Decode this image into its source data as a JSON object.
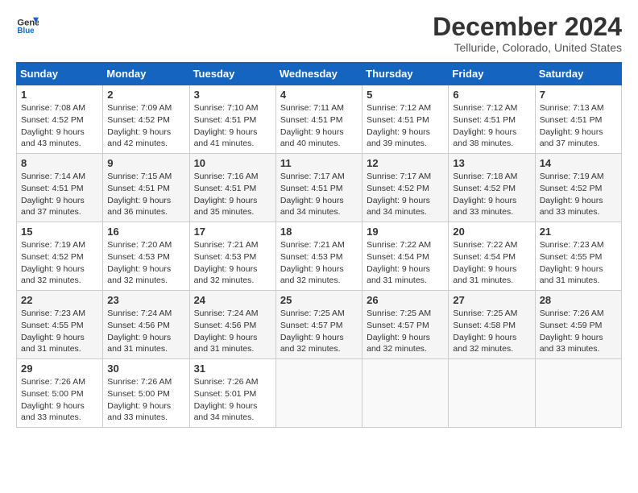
{
  "logo": {
    "line1": "General",
    "line2": "Blue"
  },
  "title": "December 2024",
  "subtitle": "Telluride, Colorado, United States",
  "weekdays": [
    "Sunday",
    "Monday",
    "Tuesday",
    "Wednesday",
    "Thursday",
    "Friday",
    "Saturday"
  ],
  "weeks": [
    [
      {
        "day": "1",
        "sunrise": "7:08 AM",
        "sunset": "4:52 PM",
        "daylight": "9 hours and 43 minutes."
      },
      {
        "day": "2",
        "sunrise": "7:09 AM",
        "sunset": "4:52 PM",
        "daylight": "9 hours and 42 minutes."
      },
      {
        "day": "3",
        "sunrise": "7:10 AM",
        "sunset": "4:51 PM",
        "daylight": "9 hours and 41 minutes."
      },
      {
        "day": "4",
        "sunrise": "7:11 AM",
        "sunset": "4:51 PM",
        "daylight": "9 hours and 40 minutes."
      },
      {
        "day": "5",
        "sunrise": "7:12 AM",
        "sunset": "4:51 PM",
        "daylight": "9 hours and 39 minutes."
      },
      {
        "day": "6",
        "sunrise": "7:12 AM",
        "sunset": "4:51 PM",
        "daylight": "9 hours and 38 minutes."
      },
      {
        "day": "7",
        "sunrise": "7:13 AM",
        "sunset": "4:51 PM",
        "daylight": "9 hours and 37 minutes."
      }
    ],
    [
      {
        "day": "8",
        "sunrise": "7:14 AM",
        "sunset": "4:51 PM",
        "daylight": "9 hours and 37 minutes."
      },
      {
        "day": "9",
        "sunrise": "7:15 AM",
        "sunset": "4:51 PM",
        "daylight": "9 hours and 36 minutes."
      },
      {
        "day": "10",
        "sunrise": "7:16 AM",
        "sunset": "4:51 PM",
        "daylight": "9 hours and 35 minutes."
      },
      {
        "day": "11",
        "sunrise": "7:17 AM",
        "sunset": "4:51 PM",
        "daylight": "9 hours and 34 minutes."
      },
      {
        "day": "12",
        "sunrise": "7:17 AM",
        "sunset": "4:52 PM",
        "daylight": "9 hours and 34 minutes."
      },
      {
        "day": "13",
        "sunrise": "7:18 AM",
        "sunset": "4:52 PM",
        "daylight": "9 hours and 33 minutes."
      },
      {
        "day": "14",
        "sunrise": "7:19 AM",
        "sunset": "4:52 PM",
        "daylight": "9 hours and 33 minutes."
      }
    ],
    [
      {
        "day": "15",
        "sunrise": "7:19 AM",
        "sunset": "4:52 PM",
        "daylight": "9 hours and 32 minutes."
      },
      {
        "day": "16",
        "sunrise": "7:20 AM",
        "sunset": "4:53 PM",
        "daylight": "9 hours and 32 minutes."
      },
      {
        "day": "17",
        "sunrise": "7:21 AM",
        "sunset": "4:53 PM",
        "daylight": "9 hours and 32 minutes."
      },
      {
        "day": "18",
        "sunrise": "7:21 AM",
        "sunset": "4:53 PM",
        "daylight": "9 hours and 32 minutes."
      },
      {
        "day": "19",
        "sunrise": "7:22 AM",
        "sunset": "4:54 PM",
        "daylight": "9 hours and 31 minutes."
      },
      {
        "day": "20",
        "sunrise": "7:22 AM",
        "sunset": "4:54 PM",
        "daylight": "9 hours and 31 minutes."
      },
      {
        "day": "21",
        "sunrise": "7:23 AM",
        "sunset": "4:55 PM",
        "daylight": "9 hours and 31 minutes."
      }
    ],
    [
      {
        "day": "22",
        "sunrise": "7:23 AM",
        "sunset": "4:55 PM",
        "daylight": "9 hours and 31 minutes."
      },
      {
        "day": "23",
        "sunrise": "7:24 AM",
        "sunset": "4:56 PM",
        "daylight": "9 hours and 31 minutes."
      },
      {
        "day": "24",
        "sunrise": "7:24 AM",
        "sunset": "4:56 PM",
        "daylight": "9 hours and 31 minutes."
      },
      {
        "day": "25",
        "sunrise": "7:25 AM",
        "sunset": "4:57 PM",
        "daylight": "9 hours and 32 minutes."
      },
      {
        "day": "26",
        "sunrise": "7:25 AM",
        "sunset": "4:57 PM",
        "daylight": "9 hours and 32 minutes."
      },
      {
        "day": "27",
        "sunrise": "7:25 AM",
        "sunset": "4:58 PM",
        "daylight": "9 hours and 32 minutes."
      },
      {
        "day": "28",
        "sunrise": "7:26 AM",
        "sunset": "4:59 PM",
        "daylight": "9 hours and 33 minutes."
      }
    ],
    [
      {
        "day": "29",
        "sunrise": "7:26 AM",
        "sunset": "5:00 PM",
        "daylight": "9 hours and 33 minutes."
      },
      {
        "day": "30",
        "sunrise": "7:26 AM",
        "sunset": "5:00 PM",
        "daylight": "9 hours and 33 minutes."
      },
      {
        "day": "31",
        "sunrise": "7:26 AM",
        "sunset": "5:01 PM",
        "daylight": "9 hours and 34 minutes."
      },
      null,
      null,
      null,
      null
    ]
  ]
}
